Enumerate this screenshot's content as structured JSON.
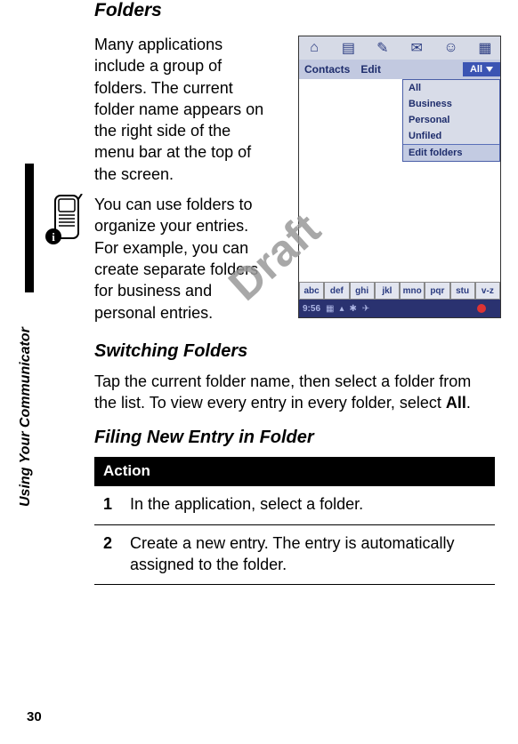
{
  "page": {
    "section_label": "Using Your Communicator",
    "number": "30"
  },
  "headings": {
    "folders": "Folders",
    "switching": "Switching Folders",
    "filing": "Filing New Entry in Folder"
  },
  "paragraphs": {
    "p1": "Many applications include a group of folders. The current folder name appears on the right side of the menu bar at the top of the screen.",
    "p2": "You can use folders to organize your entries. For example, you can create separate folders for business and personal entries.",
    "p3a": "Tap the current folder name, then select a folder from the list. To view every entry in every folder, select ",
    "p3b": "All",
    "p3c": "."
  },
  "table": {
    "header": "Action",
    "rows": [
      {
        "num": "1",
        "text": "In the application, select a folder."
      },
      {
        "num": "2",
        "text": "Create a new entry. The entry is automatically assigned to the folder."
      }
    ]
  },
  "screenshot": {
    "menubar": {
      "contacts": "Contacts",
      "edit": "Edit",
      "all_btn": "All"
    },
    "dropdown": {
      "all": "All",
      "business": "Business",
      "personal": "Personal",
      "unfiled": "Unfiled",
      "edit_folders": "Edit folders"
    },
    "keyboard": [
      "abc",
      "def",
      "ghi",
      "jkl",
      "mno",
      "pqr",
      "stu",
      "v-z"
    ],
    "status": {
      "time": "9:56"
    },
    "icons": {
      "home": "⌂",
      "book": "▤",
      "note": "✎",
      "mail": "✉",
      "people": "☺",
      "grid": "▦"
    }
  },
  "watermark": "Draft"
}
